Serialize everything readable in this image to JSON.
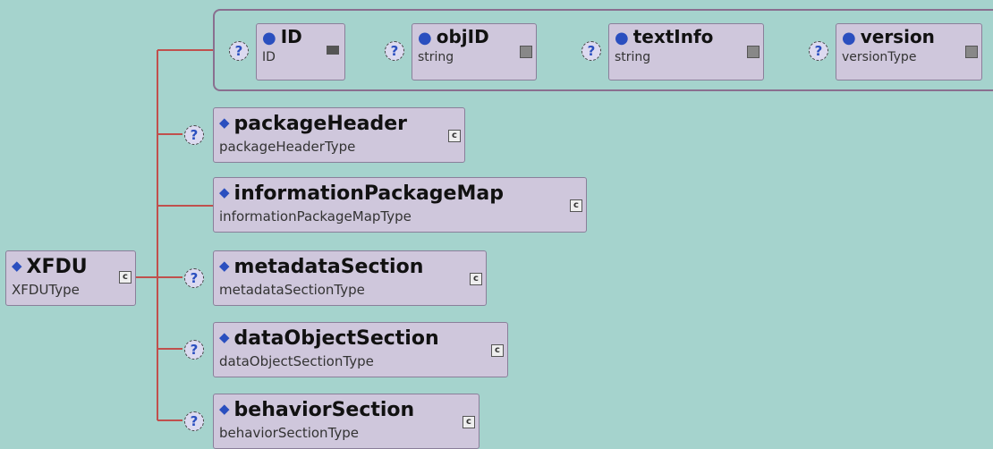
{
  "root": {
    "name": "XFDU",
    "type": "XFDUType"
  },
  "attributes": [
    {
      "name": "ID",
      "type": "ID"
    },
    {
      "name": "objID",
      "type": "string"
    },
    {
      "name": "textInfo",
      "type": "string"
    },
    {
      "name": "version",
      "type": "versionType"
    }
  ],
  "children": [
    {
      "name": "packageHeader",
      "type": "packageHeaderType",
      "optional": true
    },
    {
      "name": "informationPackageMap",
      "type": "informationPackageMapType",
      "optional": false
    },
    {
      "name": "metadataSection",
      "type": "metadataSectionType",
      "optional": true
    },
    {
      "name": "dataObjectSection",
      "type": "dataObjectSectionType",
      "optional": true
    },
    {
      "name": "behaviorSection",
      "type": "behaviorSectionType",
      "optional": true
    }
  ],
  "icons": {
    "optional": "?",
    "complex": "c"
  },
  "colors": {
    "background": "#a5d3cd",
    "box": "#cfc7dc",
    "connector": "#c0504d",
    "marker": "#2a4fbf"
  }
}
